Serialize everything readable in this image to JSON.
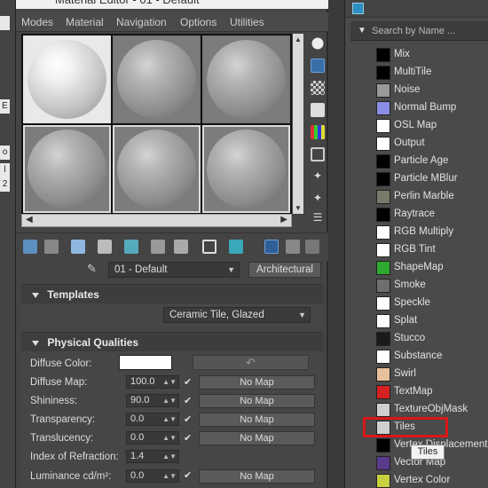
{
  "left_strip": {
    "chips": [
      "",
      "E",
      "o",
      "l",
      "2"
    ]
  },
  "material_editor": {
    "title": "Material Editor - 01 - Default",
    "menu": [
      "Modes",
      "Material",
      "Navigation",
      "Options",
      "Utilities"
    ],
    "slots_count": 6,
    "name_value": "01 - Default",
    "type_label": "Architectural",
    "templates": {
      "header": "Templates",
      "value": "Ceramic Tile, Glazed"
    },
    "physical": {
      "header": "Physical Qualities",
      "diffuse_color_label": "Diffuse Color:",
      "diffuse_color": "#ffffff",
      "rows": [
        {
          "label": "Diffuse Map:",
          "value": "100.0",
          "checked": true,
          "map": "No Map"
        },
        {
          "label": "Shininess:",
          "value": "90.0",
          "checked": true,
          "map": "No Map"
        },
        {
          "label": "Transparency:",
          "value": "0.0",
          "checked": true,
          "map": "No Map"
        },
        {
          "label": "Translucency:",
          "value": "0.0",
          "checked": true,
          "map": "No Map"
        }
      ],
      "ior_label": "Index of Refraction:",
      "ior_value": "1.4",
      "luminance_label": "Luminance cd/m²:",
      "luminance_value": "0.0",
      "luminance_map": "No Map"
    }
  },
  "map_browser": {
    "search_placeholder": "Search by Name ...",
    "items": [
      {
        "label": "Mix",
        "swatch": "#000000"
      },
      {
        "label": "MultiTile",
        "swatch": "#000000"
      },
      {
        "label": "Noise",
        "swatch": "#9a9a9a"
      },
      {
        "label": "Normal Bump",
        "swatch": "#8a8ee6"
      },
      {
        "label": "OSL Map",
        "swatch": "#ffffff"
      },
      {
        "label": "Output",
        "swatch": "#ffffff"
      },
      {
        "label": "Particle Age",
        "swatch": "#000000"
      },
      {
        "label": "Particle MBlur",
        "swatch": "#000000"
      },
      {
        "label": "Perlin Marble",
        "swatch": "#7a7a6a"
      },
      {
        "label": "Raytrace",
        "swatch": "#000000"
      },
      {
        "label": "RGB Multiply",
        "swatch": "#ffffff"
      },
      {
        "label": "RGB Tint",
        "swatch": "#ffffff"
      },
      {
        "label": "ShapeMap",
        "swatch": "#2ea82e"
      },
      {
        "label": "Smoke",
        "swatch": "#6e6e6e"
      },
      {
        "label": "Speckle",
        "swatch": "#ffffff"
      },
      {
        "label": "Splat",
        "swatch": "#ffffff"
      },
      {
        "label": "Stucco",
        "swatch": "#1a1a1a"
      },
      {
        "label": "Substance",
        "swatch": "#ffffff"
      },
      {
        "label": "Swirl",
        "swatch": "#e8c09a"
      },
      {
        "label": "TextMap",
        "swatch": "#d42020"
      },
      {
        "label": "TextureObjMask",
        "swatch": "#cfcfcf"
      },
      {
        "label": "Tiles",
        "swatch": "#cfcfcf"
      },
      {
        "label": "Vertex Displacement",
        "swatch": "#000000"
      },
      {
        "label": "Vector Map",
        "swatch": "#5a3a8a"
      },
      {
        "label": "Vertex Color",
        "swatch": "#c8d040"
      }
    ],
    "highlighted_item": "Tiles",
    "tooltip": "Tiles"
  }
}
